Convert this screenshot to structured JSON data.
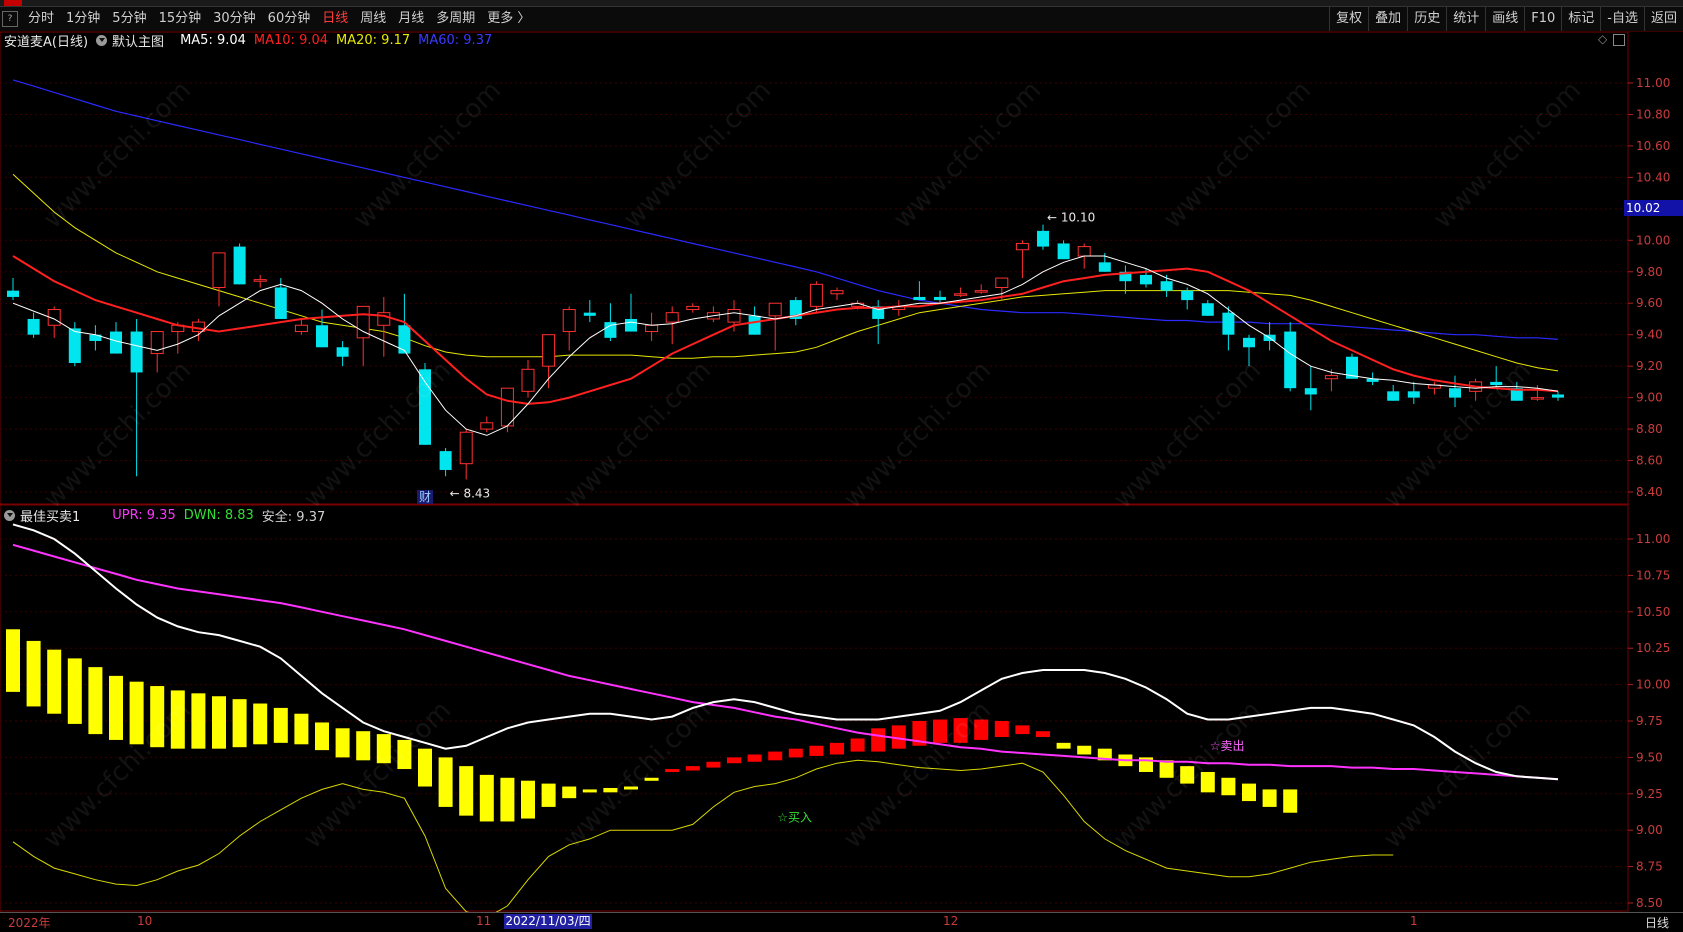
{
  "toolbar": {
    "left_items": [
      "分时",
      "1分钟",
      "5分钟",
      "15分钟",
      "30分钟",
      "60分钟",
      "日线",
      "周线",
      "月线",
      "多周期",
      "更多 〉"
    ],
    "active_item": "日线",
    "right_items": [
      "复权",
      "叠加",
      "历史",
      "统计",
      "画线",
      "F10",
      "标记",
      "-自选",
      "返回"
    ]
  },
  "main_panel": {
    "title": "安道麦A(日线)",
    "indicator_name": "默认主图",
    "ma5": "MA5: 9.04",
    "ma10": "MA10: 9.04",
    "ma20": "MA20: 9.17",
    "ma60": "MA60: 9.37",
    "high_label": "10.10",
    "low_label": "8.43",
    "event_mark": "财",
    "current_price": "10.02",
    "y_ticks": [
      "11.00",
      "10.80",
      "10.60",
      "10.40",
      "10.20",
      "10.00",
      "9.80",
      "9.60",
      "9.40",
      "9.20",
      "9.00",
      "8.80",
      "8.60",
      "8.40"
    ]
  },
  "sub_panel": {
    "indicator_name": "最佳买卖1",
    "upr": "UPR: 9.35",
    "dwn": "DWN: 8.83",
    "safe": "安全: 9.37",
    "buy_label": "☆买入",
    "sell_label": "☆卖出",
    "y_ticks": [
      "11.00",
      "10.75",
      "10.50",
      "10.25",
      "10.00",
      "9.75",
      "9.50",
      "9.25",
      "9.00",
      "8.75",
      "8.50"
    ]
  },
  "bottom_axis": {
    "labels": [
      "2022年",
      "10",
      "11",
      "12",
      "1"
    ],
    "selected_date": "2022/11/03/四",
    "period": "日线"
  },
  "watermark": "www.cfchi.com",
  "colors": {
    "up": "#ff3030",
    "down": "#00e5ee",
    "ma5": "#ffffff",
    "ma10": "#ff2020",
    "ma20": "#e8e800",
    "ma60": "#2a2aff",
    "upr": "#ff33ff",
    "dwn": "#33dd33",
    "safe_bar": "#ffff00",
    "danger_bar": "#ff0000"
  },
  "chart_data": {
    "type": "candlestick",
    "main": {
      "candles_ohlc": [
        [
          9.68,
          9.76,
          9.62,
          9.64
        ],
        [
          9.5,
          9.54,
          9.38,
          9.4
        ],
        [
          9.46,
          9.58,
          9.38,
          9.56
        ],
        [
          9.44,
          9.48,
          9.2,
          9.22
        ],
        [
          9.4,
          9.46,
          9.3,
          9.36
        ],
        [
          9.42,
          9.48,
          9.28,
          9.28
        ],
        [
          9.42,
          9.5,
          8.5,
          9.16
        ],
        [
          9.28,
          9.42,
          9.16,
          9.42
        ],
        [
          9.42,
          9.48,
          9.28,
          9.46
        ],
        [
          9.42,
          9.5,
          9.36,
          9.48
        ],
        [
          9.7,
          9.92,
          9.58,
          9.92
        ],
        [
          9.96,
          9.98,
          9.72,
          9.72
        ],
        [
          9.74,
          9.78,
          9.7,
          9.75
        ],
        [
          9.7,
          9.76,
          9.5,
          9.5
        ],
        [
          9.42,
          9.5,
          9.4,
          9.46
        ],
        [
          9.46,
          9.56,
          9.32,
          9.32
        ],
        [
          9.32,
          9.36,
          9.2,
          9.26
        ],
        [
          9.38,
          9.58,
          9.2,
          9.58
        ],
        [
          9.46,
          9.64,
          9.26,
          9.54
        ],
        [
          9.46,
          9.66,
          9.4,
          9.28
        ],
        [
          9.18,
          9.22,
          8.7,
          8.7
        ],
        [
          8.66,
          8.68,
          8.5,
          8.54
        ],
        [
          8.58,
          8.8,
          8.48,
          8.78
        ],
        [
          8.8,
          8.88,
          8.78,
          8.84
        ],
        [
          8.82,
          9.06,
          8.78,
          9.06
        ],
        [
          9.04,
          9.24,
          9.0,
          9.18
        ],
        [
          9.2,
          9.4,
          9.06,
          9.4
        ],
        [
          9.42,
          9.58,
          9.3,
          9.56
        ],
        [
          9.54,
          9.62,
          9.48,
          9.52
        ],
        [
          9.48,
          9.6,
          9.36,
          9.38
        ],
        [
          9.5,
          9.66,
          9.42,
          9.42
        ],
        [
          9.42,
          9.54,
          9.36,
          9.46
        ],
        [
          9.48,
          9.58,
          9.34,
          9.54
        ],
        [
          9.56,
          9.6,
          9.54,
          9.58
        ],
        [
          9.5,
          9.58,
          9.48,
          9.54
        ],
        [
          9.48,
          9.62,
          9.42,
          9.56
        ],
        [
          9.52,
          9.58,
          9.4,
          9.4
        ],
        [
          9.52,
          9.6,
          9.3,
          9.6
        ],
        [
          9.62,
          9.64,
          9.46,
          9.5
        ],
        [
          9.58,
          9.74,
          9.54,
          9.72
        ],
        [
          9.66,
          9.7,
          9.62,
          9.68
        ],
        [
          9.58,
          9.62,
          9.56,
          9.6
        ],
        [
          9.58,
          9.62,
          9.34,
          9.5
        ],
        [
          9.56,
          9.62,
          9.52,
          9.58
        ],
        [
          9.64,
          9.74,
          9.62,
          9.62
        ],
        [
          9.64,
          9.68,
          9.6,
          9.62
        ],
        [
          9.66,
          9.7,
          9.64,
          9.66
        ],
        [
          9.68,
          9.72,
          9.66,
          9.68
        ],
        [
          9.7,
          9.76,
          9.62,
          9.76
        ],
        [
          9.94,
          10.0,
          9.76,
          9.98
        ],
        [
          10.06,
          10.1,
          9.94,
          9.96
        ],
        [
          9.98,
          10.0,
          9.88,
          9.88
        ],
        [
          9.9,
          9.98,
          9.82,
          9.96
        ],
        [
          9.86,
          9.92,
          9.8,
          9.8
        ],
        [
          9.8,
          9.84,
          9.66,
          9.74
        ],
        [
          9.78,
          9.82,
          9.7,
          9.72
        ],
        [
          9.74,
          9.78,
          9.64,
          9.68
        ],
        [
          9.68,
          9.7,
          9.56,
          9.62
        ],
        [
          9.6,
          9.62,
          9.52,
          9.52
        ],
        [
          9.54,
          9.58,
          9.3,
          9.4
        ],
        [
          9.38,
          9.4,
          9.2,
          9.32
        ],
        [
          9.4,
          9.48,
          9.3,
          9.36
        ],
        [
          9.42,
          9.48,
          9.04,
          9.06
        ],
        [
          9.06,
          9.2,
          8.92,
          9.02
        ],
        [
          9.12,
          9.18,
          9.04,
          9.14
        ],
        [
          9.26,
          9.28,
          9.12,
          9.12
        ],
        [
          9.12,
          9.16,
          9.08,
          9.1
        ],
        [
          9.04,
          9.08,
          8.98,
          8.98
        ],
        [
          9.04,
          9.1,
          8.96,
          9.0
        ],
        [
          9.06,
          9.1,
          9.02,
          9.08
        ],
        [
          9.06,
          9.14,
          8.94,
          9.0
        ],
        [
          9.04,
          9.12,
          8.98,
          9.1
        ],
        [
          9.1,
          9.2,
          9.06,
          9.08
        ],
        [
          9.06,
          9.1,
          8.98,
          8.98
        ],
        [
          9.0,
          9.08,
          8.98,
          9.0
        ],
        [
          9.02,
          9.04,
          8.98,
          9.0
        ]
      ],
      "ma5": [
        9.6,
        9.55,
        9.5,
        9.42,
        9.4,
        9.36,
        9.33,
        9.3,
        9.34,
        9.4,
        9.52,
        9.6,
        9.68,
        9.72,
        9.68,
        9.6,
        9.5,
        9.42,
        9.36,
        9.3,
        9.1,
        8.92,
        8.8,
        8.76,
        8.82,
        8.96,
        9.12,
        9.26,
        9.38,
        9.46,
        9.48,
        9.46,
        9.47,
        9.5,
        9.52,
        9.54,
        9.52,
        9.5,
        9.52,
        9.56,
        9.58,
        9.6,
        9.56,
        9.58,
        9.6,
        9.6,
        9.62,
        9.64,
        9.66,
        9.72,
        9.8,
        9.86,
        9.9,
        9.9,
        9.86,
        9.82,
        9.76,
        9.72,
        9.66,
        9.56,
        9.46,
        9.38,
        9.28,
        9.2,
        9.16,
        9.14,
        9.12,
        9.11,
        9.09,
        9.08,
        9.07,
        9.06,
        9.07,
        9.07,
        9.06,
        9.04
      ],
      "ma10": [
        9.9,
        9.82,
        9.74,
        9.68,
        9.62,
        9.58,
        9.54,
        9.5,
        9.46,
        9.44,
        9.42,
        9.44,
        9.46,
        9.48,
        9.5,
        9.51,
        9.52,
        9.53,
        9.52,
        9.48,
        9.36,
        9.24,
        9.12,
        9.02,
        8.98,
        8.96,
        8.97,
        9.0,
        9.04,
        9.08,
        9.12,
        9.2,
        9.28,
        9.34,
        9.4,
        9.46,
        9.48,
        9.5,
        9.52,
        9.54,
        9.56,
        9.57,
        9.57,
        9.58,
        9.58,
        9.6,
        9.61,
        9.62,
        9.64,
        9.66,
        9.7,
        9.74,
        9.76,
        9.78,
        9.79,
        9.8,
        9.81,
        9.82,
        9.8,
        9.74,
        9.68,
        9.6,
        9.52,
        9.44,
        9.36,
        9.3,
        9.24,
        9.18,
        9.14,
        9.11,
        9.09,
        9.07,
        9.06,
        9.05,
        9.05,
        9.04
      ],
      "ma20": [
        10.42,
        10.3,
        10.18,
        10.08,
        10.0,
        9.92,
        9.86,
        9.8,
        9.76,
        9.72,
        9.68,
        9.64,
        9.6,
        9.56,
        9.52,
        9.48,
        9.46,
        9.44,
        9.42,
        9.38,
        9.33,
        9.29,
        9.27,
        9.26,
        9.26,
        9.26,
        9.26,
        9.27,
        9.27,
        9.27,
        9.27,
        9.26,
        9.25,
        9.25,
        9.26,
        9.26,
        9.27,
        9.28,
        9.29,
        9.32,
        9.37,
        9.42,
        9.46,
        9.5,
        9.54,
        9.56,
        9.58,
        9.6,
        9.62,
        9.64,
        9.65,
        9.66,
        9.67,
        9.68,
        9.68,
        9.68,
        9.68,
        9.68,
        9.68,
        9.68,
        9.67,
        9.66,
        9.65,
        9.62,
        9.58,
        9.54,
        9.5,
        9.46,
        9.42,
        9.38,
        9.34,
        9.3,
        9.26,
        9.22,
        9.19,
        9.17
      ],
      "ma60": [
        11.02,
        10.98,
        10.94,
        10.9,
        10.86,
        10.82,
        10.79,
        10.76,
        10.73,
        10.7,
        10.67,
        10.64,
        10.61,
        10.58,
        10.55,
        10.52,
        10.49,
        10.46,
        10.43,
        10.4,
        10.37,
        10.34,
        10.31,
        10.28,
        10.25,
        10.22,
        10.19,
        10.16,
        10.13,
        10.1,
        10.07,
        10.04,
        10.01,
        9.98,
        9.95,
        9.92,
        9.89,
        9.86,
        9.83,
        9.8,
        9.76,
        9.72,
        9.68,
        9.65,
        9.62,
        9.6,
        9.58,
        9.56,
        9.55,
        9.54,
        9.54,
        9.54,
        9.53,
        9.52,
        9.51,
        9.5,
        9.49,
        9.49,
        9.48,
        9.48,
        9.48,
        9.47,
        9.47,
        9.47,
        9.46,
        9.45,
        9.44,
        9.43,
        9.42,
        9.41,
        9.4,
        9.4,
        9.39,
        9.38,
        9.38,
        9.37
      ]
    },
    "sub": {
      "white_line": [
        11.1,
        11.06,
        11.0,
        10.9,
        10.78,
        10.66,
        10.55,
        10.46,
        10.4,
        10.36,
        10.34,
        10.3,
        10.26,
        10.18,
        10.06,
        9.94,
        9.84,
        9.74,
        9.68,
        9.64,
        9.6,
        9.56,
        9.58,
        9.64,
        9.7,
        9.74,
        9.76,
        9.78,
        9.8,
        9.8,
        9.78,
        9.76,
        9.78,
        9.84,
        9.88,
        9.9,
        9.88,
        9.84,
        9.8,
        9.78,
        9.76,
        9.76,
        9.76,
        9.78,
        9.8,
        9.82,
        9.88,
        9.96,
        10.04,
        10.08,
        10.1,
        10.1,
        10.1,
        10.08,
        10.04,
        9.98,
        9.9,
        9.8,
        9.76,
        9.76,
        9.78,
        9.8,
        9.82,
        9.84,
        9.84,
        9.82,
        9.8,
        9.76,
        9.72,
        9.64,
        9.54,
        9.46,
        9.4,
        9.37,
        9.36,
        9.35
      ],
      "magenta_line": [
        10.96,
        10.92,
        10.88,
        10.84,
        10.8,
        10.76,
        10.72,
        10.69,
        10.66,
        10.64,
        10.62,
        10.6,
        10.58,
        10.56,
        10.53,
        10.5,
        10.47,
        10.44,
        10.41,
        10.38,
        10.34,
        10.3,
        10.26,
        10.22,
        10.18,
        10.14,
        10.1,
        10.06,
        10.03,
        10.0,
        9.97,
        9.94,
        9.91,
        9.88,
        9.86,
        9.84,
        9.81,
        9.78,
        9.76,
        9.73,
        9.7,
        9.67,
        9.65,
        9.63,
        9.61,
        9.59,
        9.57,
        9.56,
        9.54,
        9.53,
        9.52,
        9.51,
        9.5,
        9.49,
        9.48,
        9.48,
        9.47,
        9.47,
        9.46,
        9.46,
        9.45,
        9.45,
        9.44,
        9.44,
        9.44,
        9.43,
        9.43,
        9.42,
        9.42,
        9.41,
        9.4,
        9.39,
        9.38,
        9.37,
        9.36,
        9.35
      ],
      "yellow_line": [
        8.92,
        8.82,
        8.74,
        8.7,
        8.66,
        8.63,
        8.62,
        8.66,
        8.72,
        8.76,
        8.84,
        8.96,
        9.06,
        9.14,
        9.22,
        9.28,
        9.32,
        9.28,
        9.26,
        9.22,
        8.96,
        8.6,
        8.44,
        8.4,
        8.48,
        8.66,
        8.82,
        8.9,
        8.94,
        9.0,
        9.0,
        9.0,
        9.0,
        9.04,
        9.16,
        9.26,
        9.3,
        9.32,
        9.36,
        9.42,
        9.46,
        9.48,
        9.47,
        9.45,
        9.43,
        9.42,
        9.41,
        9.42,
        9.44,
        9.46,
        9.4,
        9.24,
        9.06,
        8.94,
        8.86,
        8.8,
        8.74,
        8.72,
        8.7,
        8.68,
        8.68,
        8.7,
        8.74,
        8.78,
        8.8,
        8.82,
        8.83,
        8.83
      ],
      "bars": [
        [
          10.38,
          9.95,
          "y"
        ],
        [
          10.3,
          9.85,
          "y"
        ],
        [
          10.24,
          9.8,
          "y"
        ],
        [
          10.18,
          9.73,
          "y"
        ],
        [
          10.12,
          9.66,
          "y"
        ],
        [
          10.06,
          9.62,
          "y"
        ],
        [
          10.02,
          9.59,
          "y"
        ],
        [
          9.99,
          9.57,
          "y"
        ],
        [
          9.96,
          9.56,
          "y"
        ],
        [
          9.94,
          9.56,
          "y"
        ],
        [
          9.92,
          9.56,
          "y"
        ],
        [
          9.9,
          9.57,
          "y"
        ],
        [
          9.87,
          9.59,
          "y"
        ],
        [
          9.84,
          9.6,
          "y"
        ],
        [
          9.8,
          9.59,
          "y"
        ],
        [
          9.74,
          9.55,
          "y"
        ],
        [
          9.7,
          9.5,
          "y"
        ],
        [
          9.68,
          9.48,
          "y"
        ],
        [
          9.66,
          9.46,
          "y"
        ],
        [
          9.62,
          9.42,
          "y"
        ],
        [
          9.56,
          9.3,
          "y"
        ],
        [
          9.5,
          9.16,
          "y"
        ],
        [
          9.44,
          9.1,
          "y"
        ],
        [
          9.38,
          9.06,
          "y"
        ],
        [
          9.36,
          9.06,
          "y"
        ],
        [
          9.34,
          9.08,
          "y"
        ],
        [
          9.32,
          9.16,
          "y"
        ],
        [
          9.3,
          9.22,
          "y"
        ],
        [
          9.28,
          9.26,
          "y"
        ],
        [
          9.29,
          9.26,
          "y"
        ],
        [
          9.3,
          9.28,
          "y"
        ],
        [
          9.36,
          9.34,
          "y"
        ],
        [
          9.42,
          9.4,
          "r"
        ],
        [
          9.44,
          9.41,
          "r"
        ],
        [
          9.47,
          9.43,
          "r"
        ],
        [
          9.5,
          9.46,
          "r"
        ],
        [
          9.52,
          9.47,
          "r"
        ],
        [
          9.54,
          9.48,
          "r"
        ],
        [
          9.56,
          9.5,
          "r"
        ],
        [
          9.58,
          9.51,
          "r"
        ],
        [
          9.6,
          9.52,
          "r"
        ],
        [
          9.63,
          9.54,
          "r"
        ],
        [
          9.7,
          9.54,
          "r"
        ],
        [
          9.72,
          9.56,
          "r"
        ],
        [
          9.75,
          9.58,
          "r"
        ],
        [
          9.76,
          9.6,
          "r"
        ],
        [
          9.77,
          9.6,
          "r"
        ],
        [
          9.76,
          9.62,
          "r"
        ],
        [
          9.75,
          9.64,
          "r"
        ],
        [
          9.72,
          9.66,
          "r"
        ],
        [
          9.68,
          9.64,
          "r"
        ],
        [
          9.6,
          9.56,
          "y"
        ],
        [
          9.58,
          9.52,
          "y"
        ],
        [
          9.56,
          9.48,
          "y"
        ],
        [
          9.52,
          9.44,
          "y"
        ],
        [
          9.5,
          9.4,
          "y"
        ],
        [
          9.48,
          9.36,
          "y"
        ],
        [
          9.44,
          9.32,
          "y"
        ],
        [
          9.4,
          9.26,
          "y"
        ],
        [
          9.36,
          9.24,
          "y"
        ],
        [
          9.32,
          9.2,
          "y"
        ],
        [
          9.28,
          9.16,
          "y"
        ],
        [
          9.28,
          9.12,
          "y"
        ]
      ]
    }
  }
}
